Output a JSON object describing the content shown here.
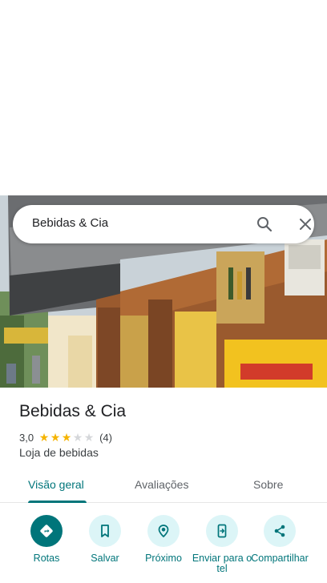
{
  "search": {
    "query": "Bebidas & Cia"
  },
  "place": {
    "name": "Bebidas & Cia",
    "rating_value": "3,0",
    "rating_stars": 3,
    "rating_max": 5,
    "review_count": "(4)",
    "category": "Loja de bebidas"
  },
  "tabs": [
    {
      "label": "Visão geral",
      "active": true
    },
    {
      "label": "Avaliações",
      "active": false
    },
    {
      "label": "Sobre",
      "active": false
    }
  ],
  "actions": [
    {
      "label": "Rotas",
      "icon": "directions-icon"
    },
    {
      "label": "Salvar",
      "icon": "bookmark-icon"
    },
    {
      "label": "Próximo",
      "icon": "nearby-icon"
    },
    {
      "label": "Enviar para o tel",
      "icon": "send-to-phone-icon"
    },
    {
      "label": "Compartilhar",
      "icon": "share-icon"
    }
  ],
  "colors": {
    "accent": "#00757a",
    "accent_light": "#dcf5f7",
    "star": "#f5b400"
  }
}
